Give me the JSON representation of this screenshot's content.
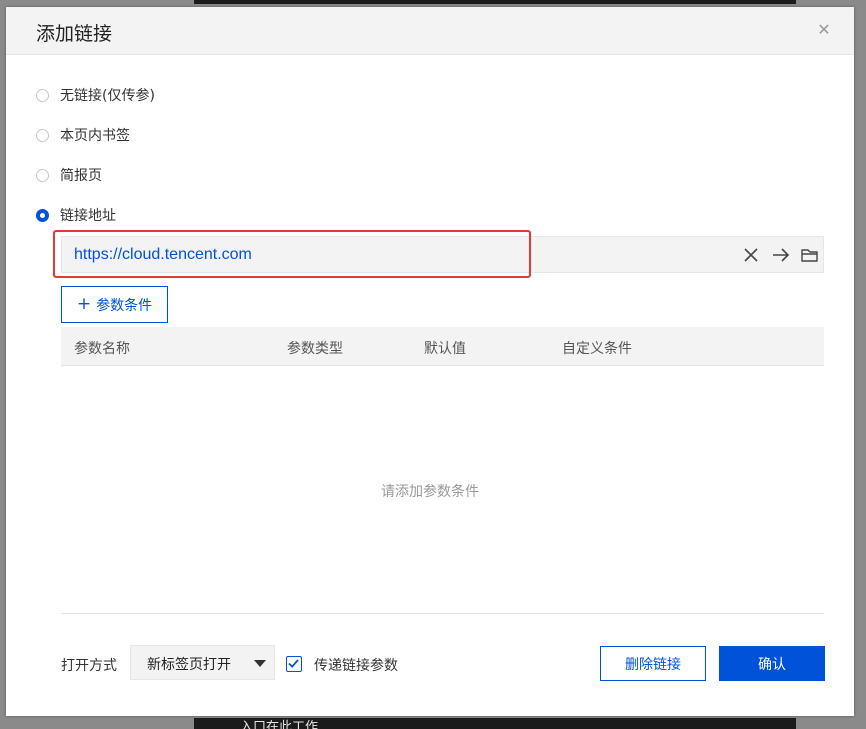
{
  "background": {
    "bottom_text": "入口在此工作"
  },
  "dialog": {
    "title": "添加链接",
    "close_icon": "close-icon"
  },
  "link_options": [
    {
      "label": "无链接(仅传参)",
      "checked": false
    },
    {
      "label": "本页内书签",
      "checked": false
    },
    {
      "label": "简报页",
      "checked": false
    },
    {
      "label": "链接地址",
      "checked": true
    }
  ],
  "url_field": {
    "value": "https://cloud.tencent.com",
    "icons": [
      "clear-icon",
      "go-arrow-icon",
      "folder-icon"
    ]
  },
  "params": {
    "add_button_label": "参数条件",
    "columns": [
      "参数名称",
      "参数类型",
      "默认值",
      "自定义条件"
    ],
    "empty_text": "请添加参数条件"
  },
  "footer": {
    "open_mode_label": "打开方式",
    "open_mode_value": "新标签页打开",
    "pass_params_label": "传递链接参数",
    "pass_params_checked": true,
    "delete_button": "删除链接",
    "confirm_button": "确认"
  },
  "colors": {
    "accent": "#0052d9",
    "highlight": "#e53935"
  }
}
